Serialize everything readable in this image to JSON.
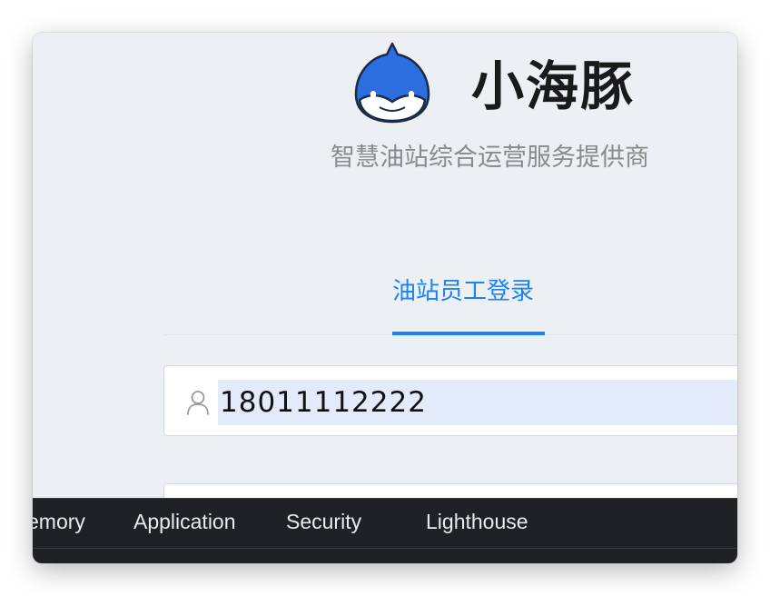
{
  "brand": {
    "name": "小海豚",
    "slogan": "智慧油站综合运营服务提供商",
    "logo_icon": "dolphin-logo-icon"
  },
  "login": {
    "tab_label": "油站员工登录",
    "phone_value": "18011112222",
    "user_icon": "user-icon"
  },
  "devtools": {
    "tabs": [
      "emory",
      "Application",
      "Security",
      "Lighthouse"
    ]
  },
  "colors": {
    "accent": "#1a82f2",
    "page_bg": "#eceff4",
    "autofill_bg": "#e3ebfb",
    "devtools_bg": "#202124",
    "logo_blue": "#2a6ee0"
  }
}
